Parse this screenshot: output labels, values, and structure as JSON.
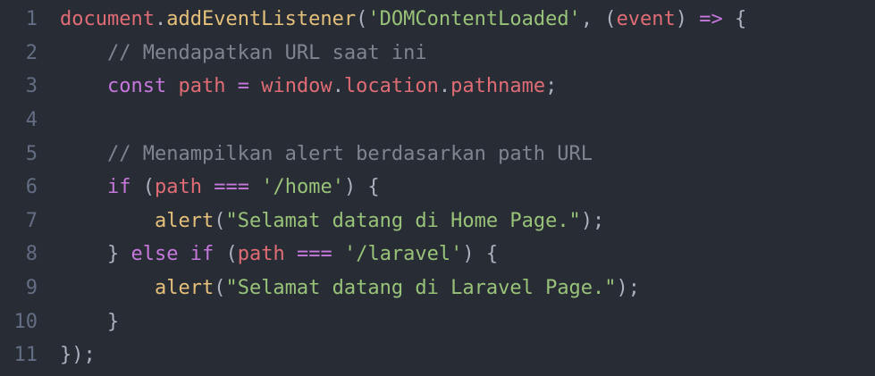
{
  "editor": {
    "lines": [
      {
        "number": "1",
        "tokens": [
          {
            "text": "document",
            "kind": "var"
          },
          {
            "text": ".",
            "kind": "plain"
          },
          {
            "text": "addEventListener",
            "kind": "fn"
          },
          {
            "text": "(",
            "kind": "plain"
          },
          {
            "text": "'DOMContentLoaded'",
            "kind": "str"
          },
          {
            "text": ", (",
            "kind": "plain"
          },
          {
            "text": "event",
            "kind": "param"
          },
          {
            "text": ") ",
            "kind": "plain"
          },
          {
            "text": "=>",
            "kind": "kw"
          },
          {
            "text": " {",
            "kind": "plain"
          }
        ]
      },
      {
        "number": "2",
        "tokens": [
          {
            "text": "    // Mendapatkan URL saat ini",
            "kind": "comment"
          }
        ]
      },
      {
        "number": "3",
        "tokens": [
          {
            "text": "    ",
            "kind": "plain"
          },
          {
            "text": "const",
            "kind": "kw"
          },
          {
            "text": " ",
            "kind": "plain"
          },
          {
            "text": "path",
            "kind": "var"
          },
          {
            "text": " ",
            "kind": "plain"
          },
          {
            "text": "=",
            "kind": "kw"
          },
          {
            "text": " ",
            "kind": "plain"
          },
          {
            "text": "window",
            "kind": "var"
          },
          {
            "text": ".",
            "kind": "plain"
          },
          {
            "text": "location",
            "kind": "var"
          },
          {
            "text": ".",
            "kind": "plain"
          },
          {
            "text": "pathname",
            "kind": "var"
          },
          {
            "text": ";",
            "kind": "plain"
          }
        ]
      },
      {
        "number": "4",
        "tokens": []
      },
      {
        "number": "5",
        "tokens": [
          {
            "text": "    // Menampilkan alert berdasarkan path URL",
            "kind": "comment"
          }
        ]
      },
      {
        "number": "6",
        "tokens": [
          {
            "text": "    ",
            "kind": "plain"
          },
          {
            "text": "if",
            "kind": "kw"
          },
          {
            "text": " (",
            "kind": "plain"
          },
          {
            "text": "path",
            "kind": "var"
          },
          {
            "text": " ",
            "kind": "plain"
          },
          {
            "text": "===",
            "kind": "kw"
          },
          {
            "text": " ",
            "kind": "plain"
          },
          {
            "text": "'/home'",
            "kind": "str"
          },
          {
            "text": ") {",
            "kind": "plain"
          }
        ]
      },
      {
        "number": "7",
        "tokens": [
          {
            "text": "        ",
            "kind": "plain"
          },
          {
            "text": "alert",
            "kind": "fn"
          },
          {
            "text": "(",
            "kind": "plain"
          },
          {
            "text": "\"Selamat datang di Home Page.\"",
            "kind": "str"
          },
          {
            "text": ");",
            "kind": "plain"
          }
        ]
      },
      {
        "number": "8",
        "tokens": [
          {
            "text": "    } ",
            "kind": "plain"
          },
          {
            "text": "else",
            "kind": "kw"
          },
          {
            "text": " ",
            "kind": "plain"
          },
          {
            "text": "if",
            "kind": "kw"
          },
          {
            "text": " (",
            "kind": "plain"
          },
          {
            "text": "path",
            "kind": "var"
          },
          {
            "text": " ",
            "kind": "plain"
          },
          {
            "text": "===",
            "kind": "kw"
          },
          {
            "text": " ",
            "kind": "plain"
          },
          {
            "text": "'/laravel'",
            "kind": "str"
          },
          {
            "text": ") {",
            "kind": "plain"
          }
        ]
      },
      {
        "number": "9",
        "tokens": [
          {
            "text": "        ",
            "kind": "plain"
          },
          {
            "text": "alert",
            "kind": "fn"
          },
          {
            "text": "(",
            "kind": "plain"
          },
          {
            "text": "\"Selamat datang di Laravel Page.\"",
            "kind": "str"
          },
          {
            "text": ");",
            "kind": "plain"
          }
        ]
      },
      {
        "number": "10",
        "tokens": [
          {
            "text": "    }",
            "kind": "plain"
          }
        ]
      },
      {
        "number": "11",
        "tokens": [
          {
            "text": "});",
            "kind": "plain"
          }
        ]
      }
    ]
  }
}
